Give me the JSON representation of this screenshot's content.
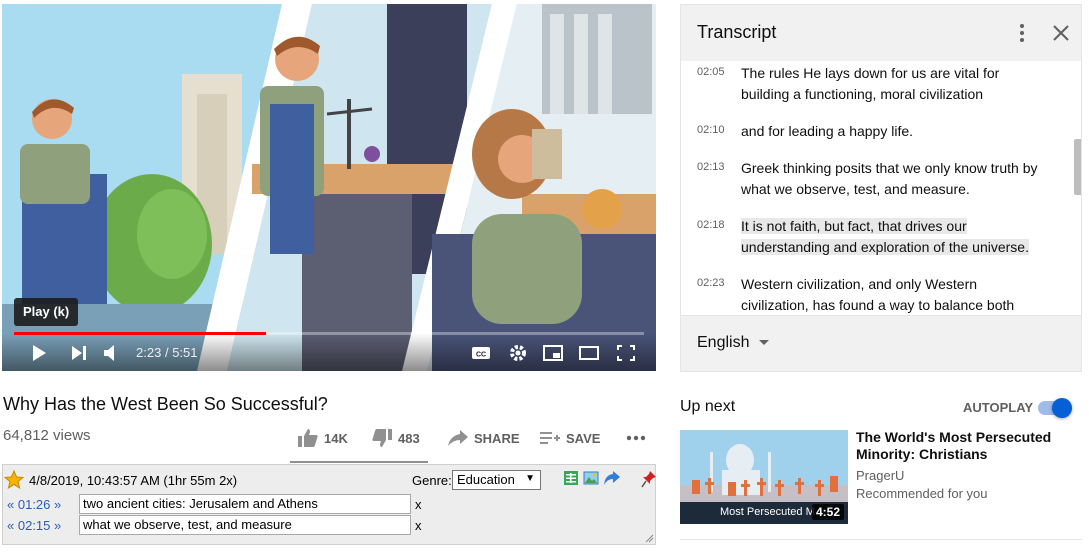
{
  "player": {
    "tooltip": "Play (k)",
    "current_time": "2:23",
    "duration": "5:51",
    "progress_fraction": 0.4,
    "time_separator": "/"
  },
  "video": {
    "title": "Why Has the West Been So Successful?",
    "views": "64,812 views",
    "likes": "14K",
    "dislikes": "483",
    "share_label": "SHARE",
    "save_label": "SAVE"
  },
  "extension": {
    "timestamp": "4/8/2019, 10:43:57 AM (1hr 55m 2x)",
    "genre_label": "Genre:",
    "genre_value": "Education",
    "notes": [
      {
        "time": "01:26",
        "text": "two ancient cities: Jerusalem and Athens",
        "remove": "x"
      },
      {
        "time": "02:15",
        "text": "what we observe, test, and measure",
        "remove": "x"
      }
    ]
  },
  "transcript": {
    "title": "Transcript",
    "language": "English",
    "cues": [
      {
        "time": "02:05",
        "text": "The rules He lays down for us are vital for building a functioning, moral civilization"
      },
      {
        "time": "02:10",
        "text": "and for leading a happy life."
      },
      {
        "time": "02:13",
        "text": "Greek thinking posits that we only know truth by what we observe, test, and measure."
      },
      {
        "time": "02:18",
        "text": "It is not faith, but fact, that drives our understanding and exploration of the universe."
      },
      {
        "time": "02:23",
        "text": "Western civilization, and only Western civilization, has found a way to balance both religious"
      }
    ]
  },
  "up_next": {
    "heading": "Up next",
    "autoplay_label": "AUTOPLAY",
    "autoplay_on": true,
    "video": {
      "title": "The World's Most Persecuted Minority: Christians",
      "channel": "PragerU",
      "meta": "Recommended for you",
      "duration": "4:52",
      "thumbnail_caption": "Most Persecuted M"
    }
  },
  "colors": {
    "progress": "#ff0000",
    "accent": "#065fd4",
    "note_time": "#2a5db0"
  }
}
